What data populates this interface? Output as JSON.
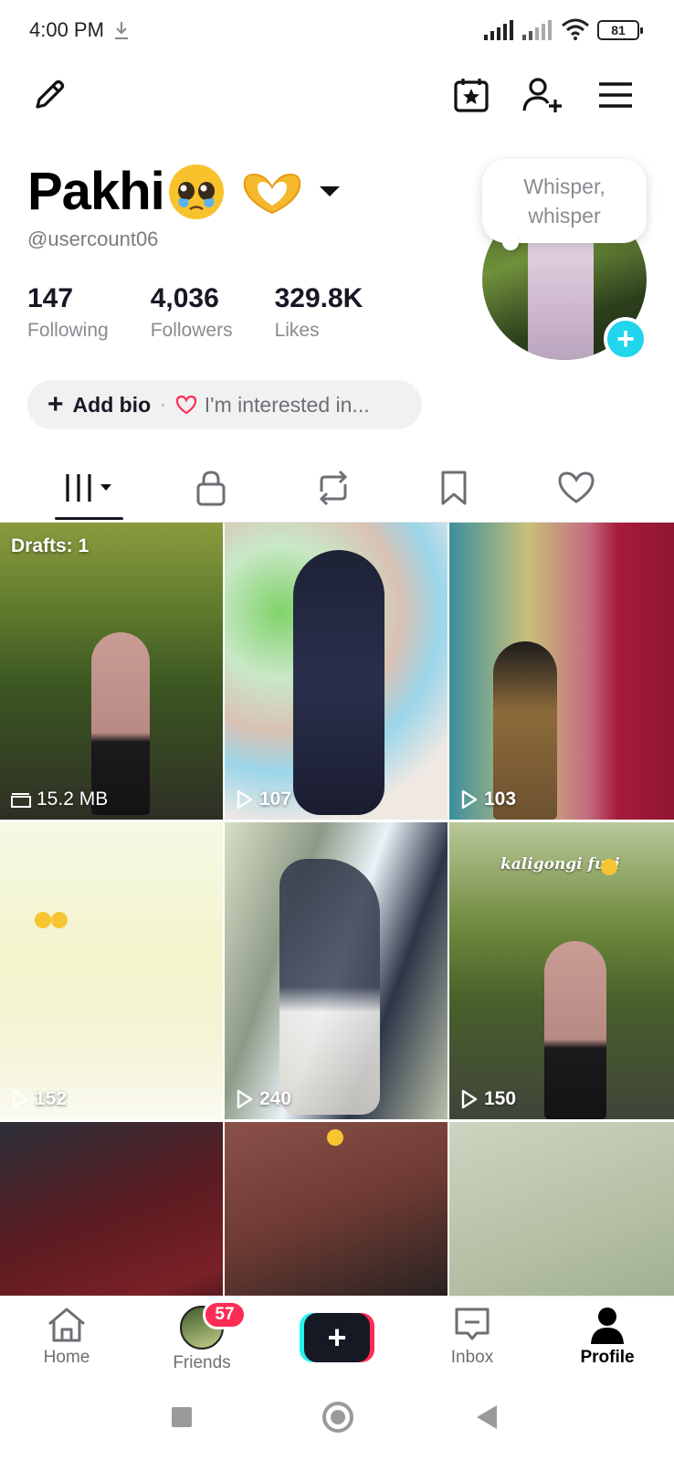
{
  "status_bar": {
    "time": "4:00 PM",
    "battery": "81",
    "icons": [
      "download-icon",
      "signal-icon",
      "signal-icon",
      "wifi-icon",
      "battery-icon"
    ]
  },
  "top_nav": {
    "icons": [
      "edit-pencil-icon",
      "calendar-star-icon",
      "add-friend-icon",
      "menu-icon"
    ]
  },
  "profile": {
    "display_name": "Pakhi",
    "emojis": [
      "pleading-face-emoji",
      "heart-hands-emoji"
    ],
    "username": "@usercount06",
    "stats": [
      {
        "value": "147",
        "label": "Following"
      },
      {
        "value": "4,036",
        "label": "Followers"
      },
      {
        "value": "329.8K",
        "label": "Likes"
      }
    ],
    "add_bio": "Add bio",
    "separator": "·",
    "interests": "I'm interested in...",
    "avatar_note": "Whisper, whisper"
  },
  "tabs": [
    {
      "icon": "videos-grid-icon",
      "active": true
    },
    {
      "icon": "lock-icon",
      "active": false
    },
    {
      "icon": "repost-icon",
      "active": false
    },
    {
      "icon": "bookmark-icon",
      "active": false
    },
    {
      "icon": "liked-heart-icon",
      "active": false
    }
  ],
  "grid": {
    "drafts_label": "Drafts: 1",
    "draft_size": "15.2 MB",
    "videos": [
      {
        "views": "107"
      },
      {
        "views": "103"
      },
      {
        "views": "152"
      },
      {
        "views": "240"
      },
      {
        "views": "150",
        "overlay_text": "kaligongi furi"
      }
    ]
  },
  "bottom_nav": {
    "items": [
      {
        "label": "Home",
        "icon": "home-icon"
      },
      {
        "label": "Friends",
        "icon": "friends-avatar"
      },
      {
        "label": "",
        "icon": "create-plus-icon"
      },
      {
        "label": "Inbox",
        "icon": "inbox-icon"
      },
      {
        "label": "Profile",
        "icon": "profile-icon"
      }
    ],
    "friends_badge": "57"
  },
  "colors": {
    "accent_cyan": "#20d5ec",
    "badge_red": "#fe2c55",
    "text_primary": "#161823",
    "text_secondary": "#8a8b91"
  }
}
